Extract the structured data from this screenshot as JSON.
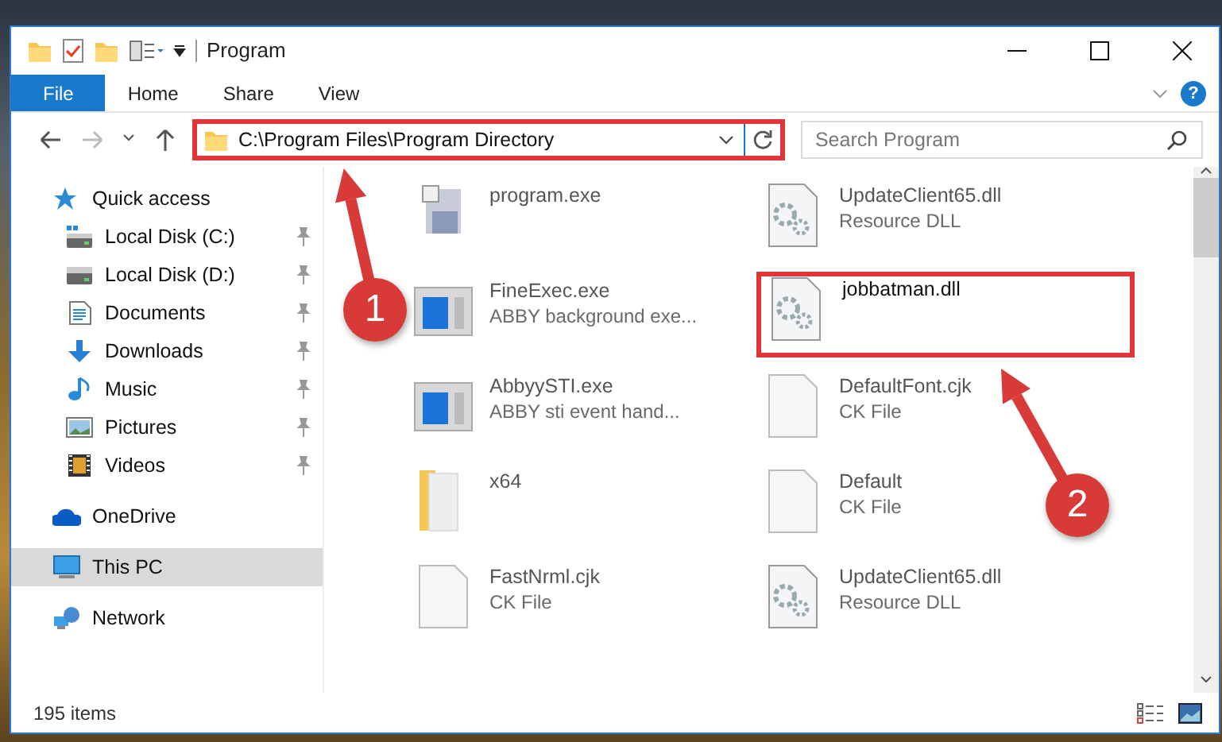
{
  "window": {
    "title": "Program"
  },
  "ribbon_tabs": [
    {
      "label": "File",
      "kind": "file"
    },
    {
      "label": "Home",
      "kind": "tab"
    },
    {
      "label": "Share",
      "kind": "tab"
    },
    {
      "label": "View",
      "kind": "tab"
    }
  ],
  "help_button": {
    "label": "?"
  },
  "address": {
    "path": "C:\\Program Files\\Program Directory",
    "highlighted": true
  },
  "search": {
    "placeholder": "Search Program"
  },
  "sidebar": {
    "items": [
      {
        "label": "Quick access",
        "kind": "star",
        "selected": false,
        "children": [
          {
            "label": "Local Disk (C:)",
            "kind": "disk-c",
            "pinned": true,
            "selected": false
          },
          {
            "label": "Local Disk (D:)",
            "kind": "disk",
            "pinned": true,
            "selected": false
          },
          {
            "label": "Documents",
            "kind": "documents",
            "pinned": true,
            "selected": false
          },
          {
            "label": "Downloads",
            "kind": "downloads",
            "pinned": true,
            "selected": false
          },
          {
            "label": "Music",
            "kind": "music",
            "pinned": true,
            "selected": false
          },
          {
            "label": "Pictures",
            "kind": "pictures",
            "pinned": true,
            "selected": false
          },
          {
            "label": "Videos",
            "kind": "videos",
            "pinned": true,
            "selected": false
          }
        ]
      },
      {
        "label": "OneDrive",
        "kind": "cloud",
        "selected": false
      },
      {
        "label": "This PC",
        "kind": "pc",
        "selected": true
      },
      {
        "label": "Network",
        "kind": "network",
        "selected": false
      }
    ]
  },
  "files": [
    {
      "name": "program.exe",
      "kind": "app",
      "faded": true,
      "highlighted": false
    },
    {
      "name": "UpdateClient65.dll",
      "type": "Resource DLL",
      "kind": "dll",
      "faded": true,
      "highlighted": false
    },
    {
      "name": "FineExec.exe",
      "type": "ABBY background exe...",
      "kind": "window",
      "faded": true,
      "highlighted": false
    },
    {
      "name": "jobbatman.dll",
      "kind": "dll",
      "faded": false,
      "highlighted": true
    },
    {
      "name": "AbbyySTI.exe",
      "type": "ABBY sti event hand...",
      "kind": "window",
      "faded": true,
      "highlighted": false
    },
    {
      "name": "DefaultFont.cjk",
      "type": "CK File",
      "kind": "file",
      "faded": true,
      "highlighted": false
    },
    {
      "name": "x64",
      "kind": "folder",
      "faded": true,
      "highlighted": false
    },
    {
      "name": "Default",
      "type": "CK File",
      "kind": "file",
      "faded": true,
      "highlighted": false
    },
    {
      "name": "FastNrml.cjk",
      "type": "CK File",
      "kind": "file",
      "faded": true,
      "highlighted": false
    },
    {
      "name": "UpdateClient65.dll",
      "type": "Resource DLL",
      "kind": "dll",
      "faded": true,
      "highlighted": false
    }
  ],
  "callouts": [
    {
      "label": "1"
    },
    {
      "label": "2"
    }
  ],
  "status_bar": {
    "text": "195 items"
  }
}
